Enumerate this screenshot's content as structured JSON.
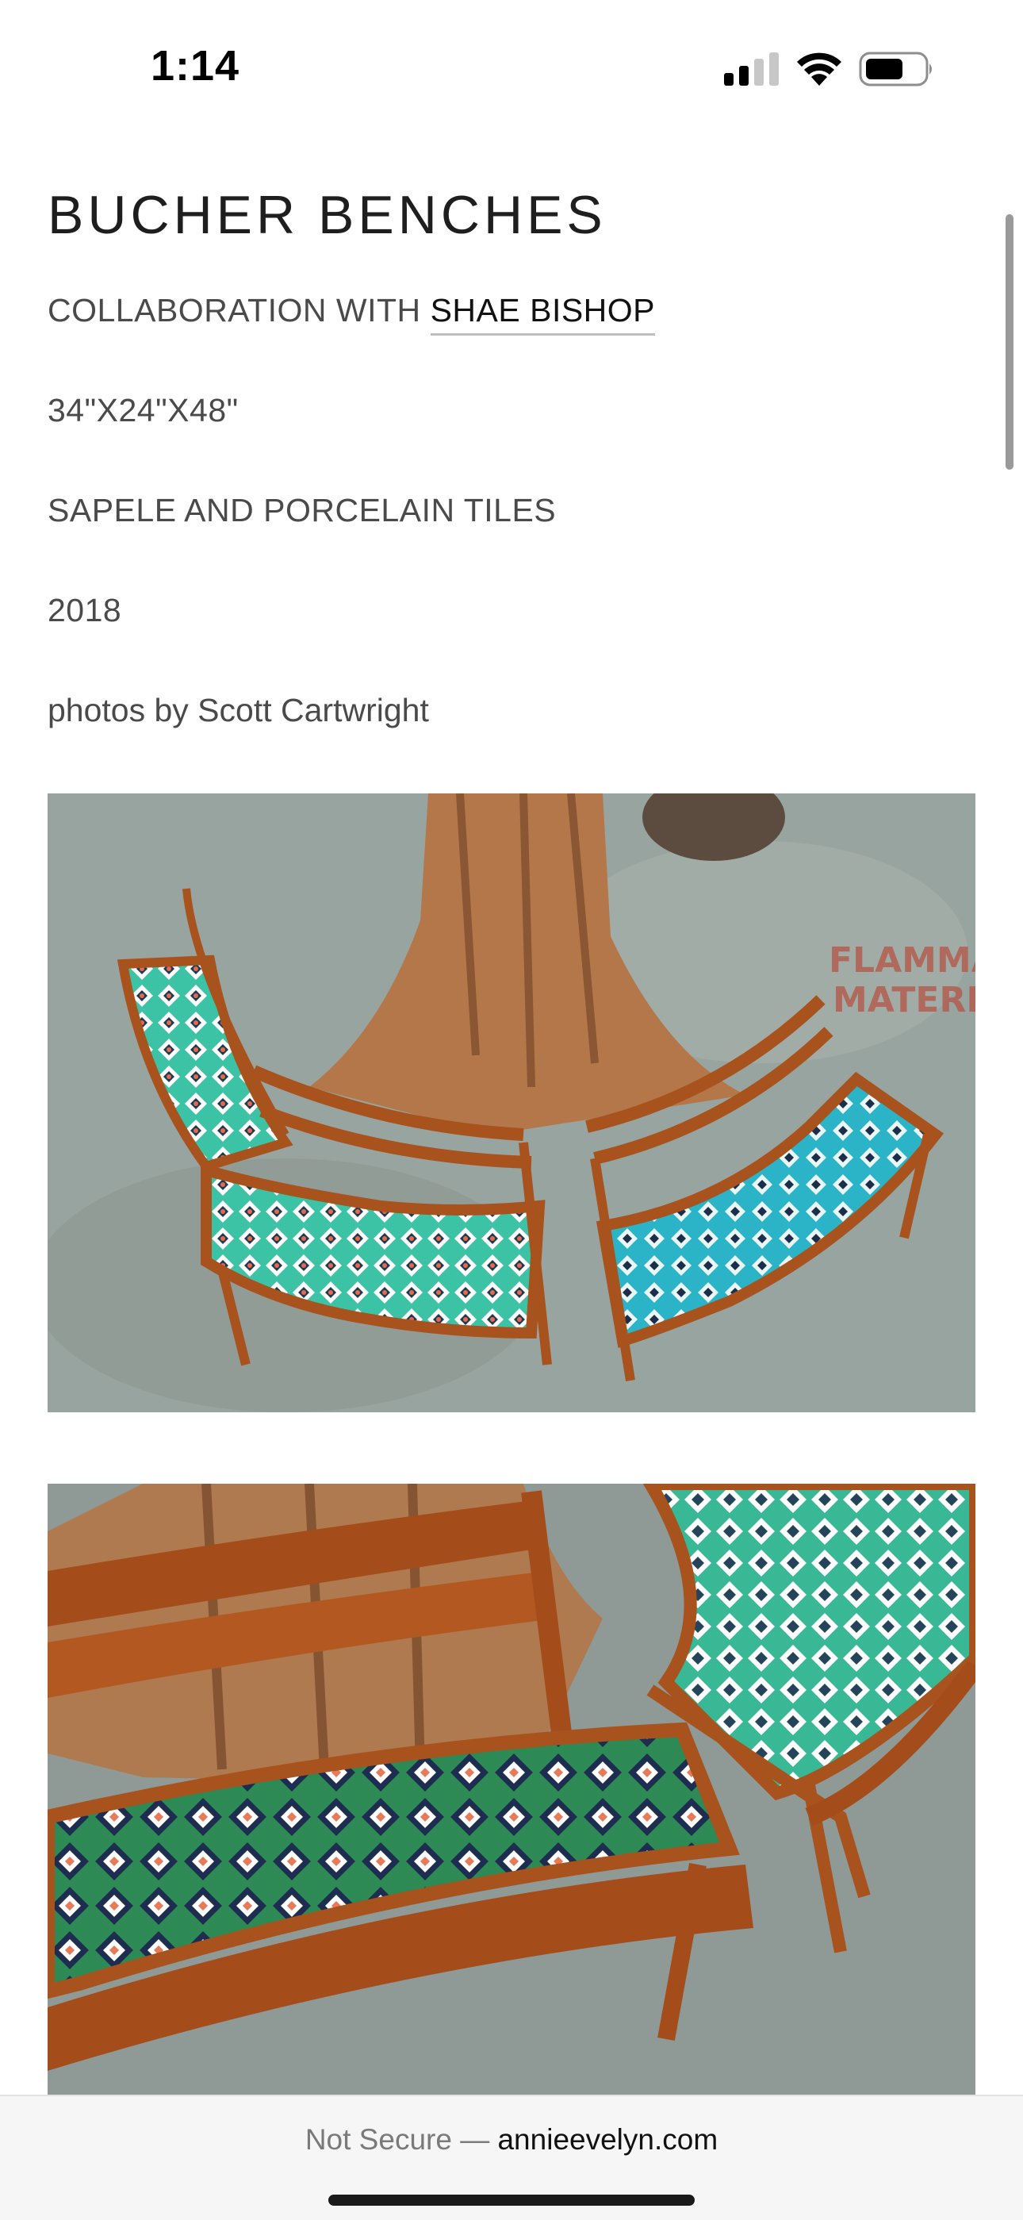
{
  "status_bar": {
    "time": "1:14",
    "signal_icon": "cellular-signal-icon",
    "wifi_icon": "wifi-icon",
    "battery_icon": "battery-icon"
  },
  "project": {
    "title": "BUCHER BENCHES",
    "collaboration_prefix": "COLLABORATION WITH ",
    "collaborator": "SHAE BISHOP",
    "dimensions": "34\"X24\"X48\"",
    "materials": "SAPELE AND PORCELAIN TILES",
    "year": "2018",
    "credit": "photos by Scott Cartwright"
  },
  "photos": [
    {
      "alt": "Three curved wooden benches with patterned tile seats arranged around a tree stump"
    },
    {
      "alt": "Close-up of curved wooden benches with green and white tile seats"
    }
  ],
  "url_bar": {
    "security": "Not Secure — ",
    "domain": "annieevelyn.com"
  },
  "colors": {
    "background": "#ffffff",
    "text_primary": "#1e1e1e",
    "text_secondary": "#4a4a4a",
    "wood": "#a8521e",
    "tile_teal": "#2fb7a6"
  }
}
